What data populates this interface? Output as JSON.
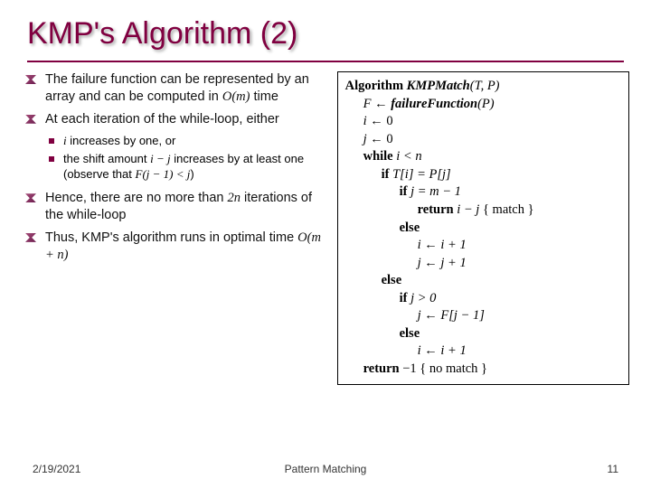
{
  "title": "KMP's Algorithm (2)",
  "bullets": {
    "b1_a": "The failure function can be represented by an array and can be computed in ",
    "b1_Om": "O(m)",
    "b1_b": " time",
    "b2": "At each iteration of the while-loop, either",
    "s1_a": "i",
    "s1_b": " increases by one, or",
    "s2_a": "the shift amount ",
    "s2_b": "i − j",
    "s2_c": " increases by at least one (observe that ",
    "s2_d": "F(j − 1) < j",
    "s2_e": ")",
    "b3_a": "Hence, there are no more than ",
    "b3_b": "2n",
    "b3_c": " iterations of the while-loop",
    "b4_a": "Thus, KMP's algorithm runs in optimal time ",
    "b4_b": "O(m + n)"
  },
  "algo": {
    "l1a": "Algorithm ",
    "l1b": "KMPMatch",
    "l1c": "(T, P)",
    "l2a": "F",
    "l2b": " ← ",
    "l2c": "failureFunction",
    "l2d": "(P)",
    "l3a": "i",
    "l3b": " ← 0",
    "l4a": "j",
    "l4b": " ← 0",
    "l5a": "while ",
    "l5b": "i < n",
    "l6a": "if ",
    "l6b": "T[i] = P[j]",
    "l7a": "if ",
    "l7b": "j = m − 1",
    "l8a": "return ",
    "l8b": "i − j",
    "l8c": " { match }",
    "l9": "else",
    "l10a": "i",
    "l10b": " ← ",
    "l10c": "i + 1",
    "l11a": "j",
    "l11b": " ← ",
    "l11c": "j + 1",
    "l12": "else",
    "l13a": "if ",
    "l13b": "j > 0",
    "l14a": "j",
    "l14b": " ← ",
    "l14c": "F[j − 1]",
    "l15": "else",
    "l16a": "i",
    "l16b": " ← ",
    "l16c": "i + 1",
    "l17a": "return ",
    "l17b": "−1",
    "l17c": " { no match }"
  },
  "footer": {
    "date": "2/19/2021",
    "center": "Pattern Matching",
    "page": "11"
  }
}
